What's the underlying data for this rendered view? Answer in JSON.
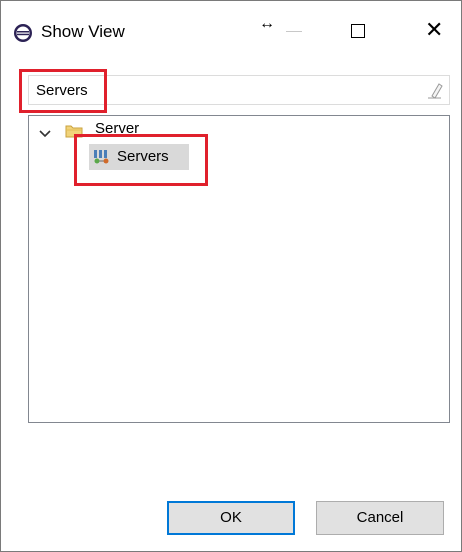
{
  "window": {
    "title": "Show View"
  },
  "filter": {
    "value": "Servers"
  },
  "tree": {
    "category": {
      "label": "Server",
      "expanded": true
    },
    "items": [
      {
        "label": "Servers",
        "selected": true
      }
    ]
  },
  "buttons": {
    "ok_label": "OK",
    "cancel_label": "Cancel"
  },
  "colors": {
    "highlight": "#e0202c",
    "default_button_border": "#0078d7",
    "selection": "#d9d9d9"
  },
  "icons": {
    "app": "eclipse-icon",
    "resize": "resize-arrows-icon",
    "clear": "eraser-icon",
    "chevron": "chevron-down-icon",
    "folder": "folder-icon",
    "servers": "servers-view-icon"
  }
}
